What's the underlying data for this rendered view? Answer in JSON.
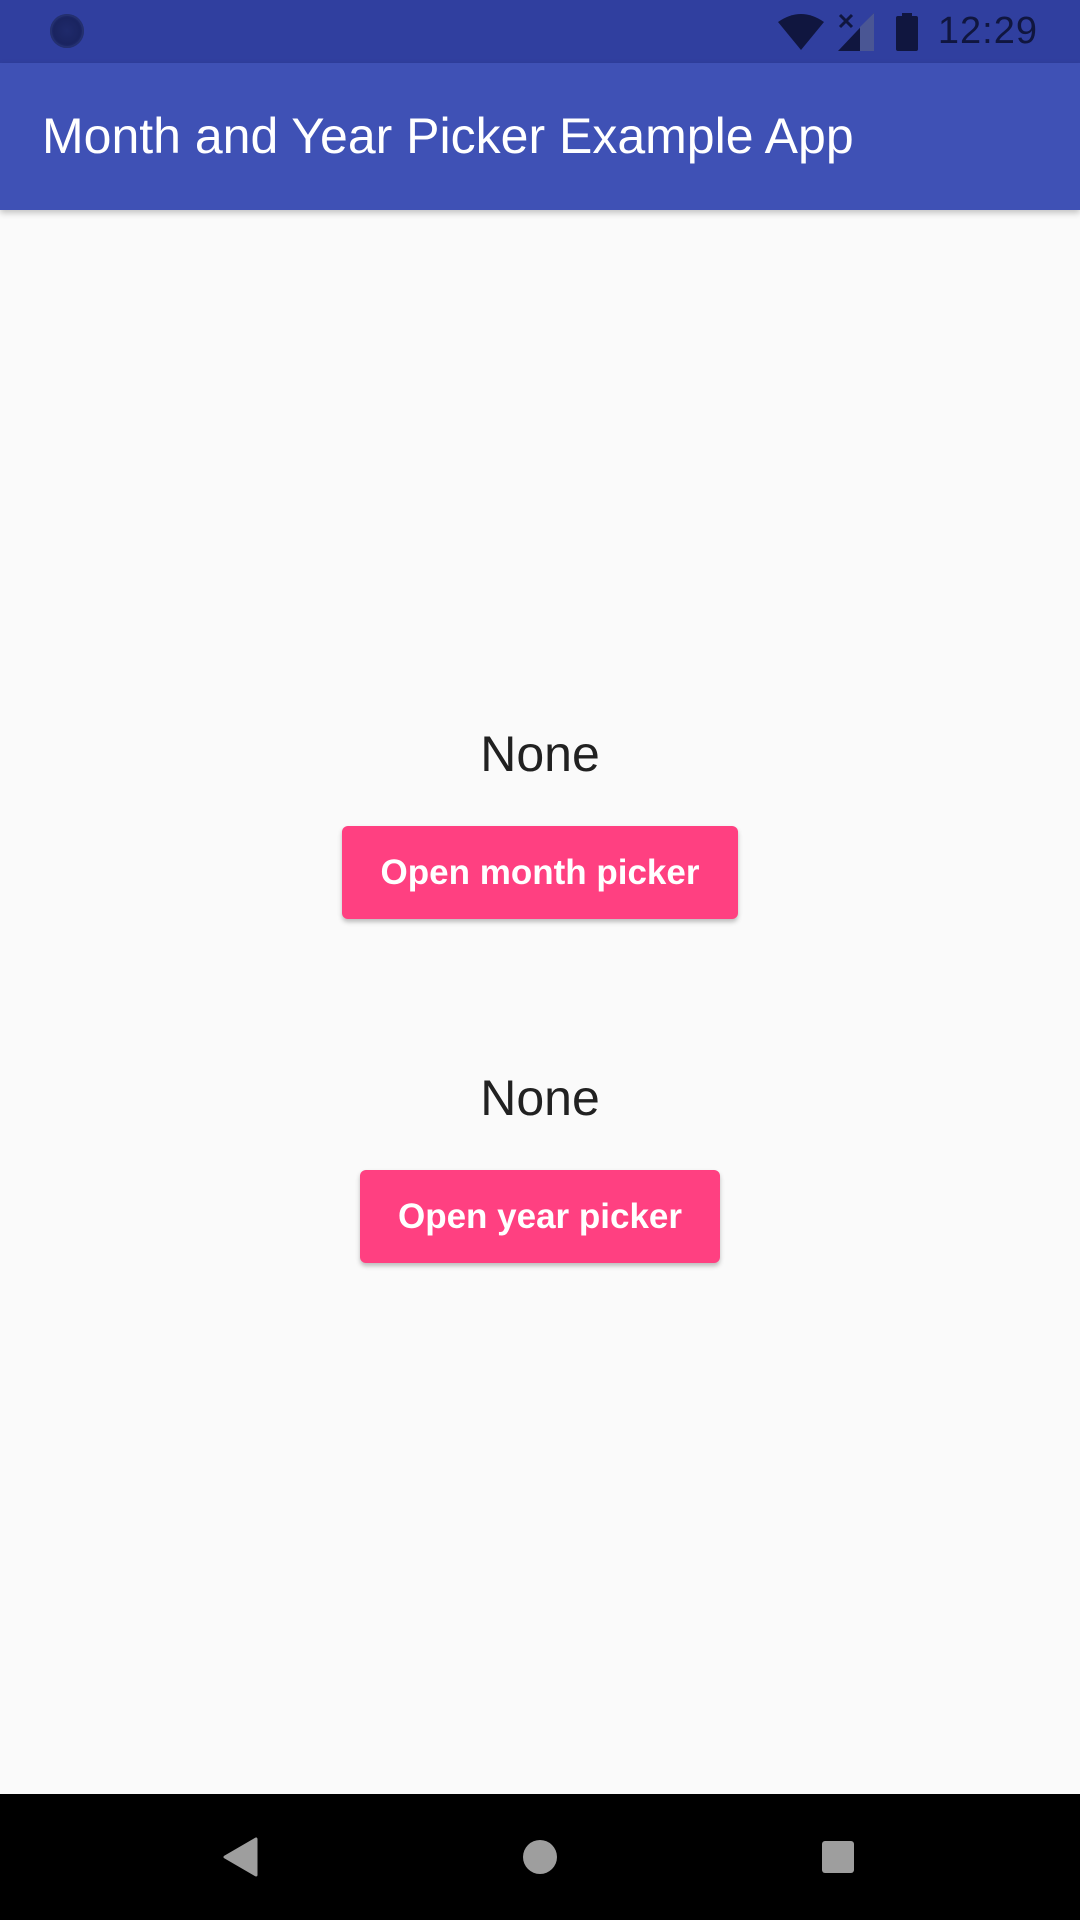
{
  "status_bar": {
    "time": "12:29",
    "icons": [
      "sync-icon",
      "wifi-icon",
      "signal-icon",
      "battery-icon"
    ]
  },
  "app_bar": {
    "title": "Month and Year Picker Example App"
  },
  "month_section": {
    "value": "None",
    "button_label": "Open month picker"
  },
  "year_section": {
    "value": "None",
    "button_label": "Open year picker"
  },
  "nav_bar": {
    "icons": [
      "back-icon",
      "home-icon",
      "recents-icon"
    ]
  },
  "colors": {
    "status_bar": "#303f9f",
    "app_bar": "#3f51b5",
    "accent": "#ff4081",
    "background": "#fafafa",
    "nav_bar": "#000000"
  }
}
